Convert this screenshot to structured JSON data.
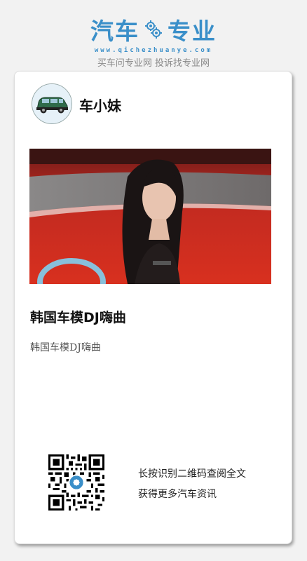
{
  "header": {
    "logo_left": "汽车",
    "logo_right": "专业",
    "logo_url": "www.qichezhuanye.com",
    "slogan": "买车问专业网 投诉找专业网"
  },
  "card": {
    "author_name": "车小妹",
    "article_title": "韩国车模DJ嗨曲",
    "article_desc": "韩国车模DJ嗨曲",
    "qr_prompt_line1": "长按识别二维码查阅全文",
    "qr_prompt_line2": "获得更多汽车资讯"
  },
  "colors": {
    "brand_blue": "#3a8fc9",
    "photo_red": "#c8231a"
  },
  "icons": {
    "logo_gear": "gear-icon",
    "avatar": "car-avatar"
  }
}
